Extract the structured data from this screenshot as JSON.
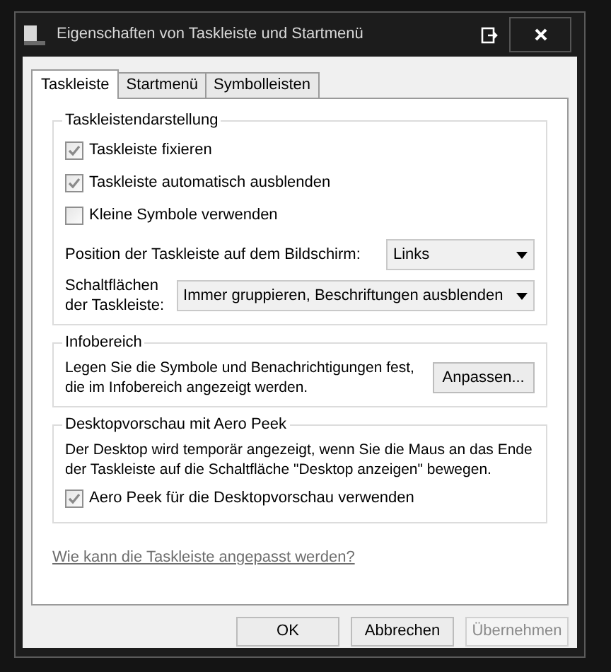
{
  "window": {
    "title": "Eigenschaften von Taskleiste und Startmenü"
  },
  "tabs": [
    {
      "label": "Taskleiste",
      "selected": true
    },
    {
      "label": "Startmenü",
      "selected": false
    },
    {
      "label": "Symbolleisten",
      "selected": false
    }
  ],
  "appearance": {
    "title": "Taskleistendarstellung",
    "checkboxes": [
      {
        "label": "Taskleiste fixieren",
        "checked": true
      },
      {
        "label": "Taskleiste automatisch ausblenden",
        "checked": true
      },
      {
        "label": "Kleine Symbole verwenden",
        "checked": false
      }
    ],
    "position": {
      "label": "Position der Taskleiste auf dem Bildschirm:",
      "value": "Links"
    },
    "buttons": {
      "label": "Schaltflächen der Taskleiste:",
      "value": "Immer gruppieren, Beschriftungen ausblenden"
    }
  },
  "notification_area": {
    "title": "Infobereich",
    "text": "Legen Sie die Symbole und Benachrichtigungen fest, die im Infobereich angezeigt werden.",
    "button": "Anpassen..."
  },
  "aero_peek": {
    "title": "Desktopvorschau mit Aero Peek",
    "text": "Der Desktop wird temporär angezeigt, wenn Sie die Maus an das Ende der Taskleiste auf die Schaltfläche \"Desktop anzeigen\" bewegen.",
    "checkbox": {
      "label": "Aero Peek für die Desktopvorschau verwenden",
      "checked": true
    }
  },
  "help_link": "Wie kann die Taskleiste angepasst werden?",
  "buttons": [
    {
      "label": "OK",
      "disabled": false
    },
    {
      "label": "Abbrechen",
      "disabled": false
    },
    {
      "label": "Übernehmen",
      "disabled": true
    }
  ]
}
